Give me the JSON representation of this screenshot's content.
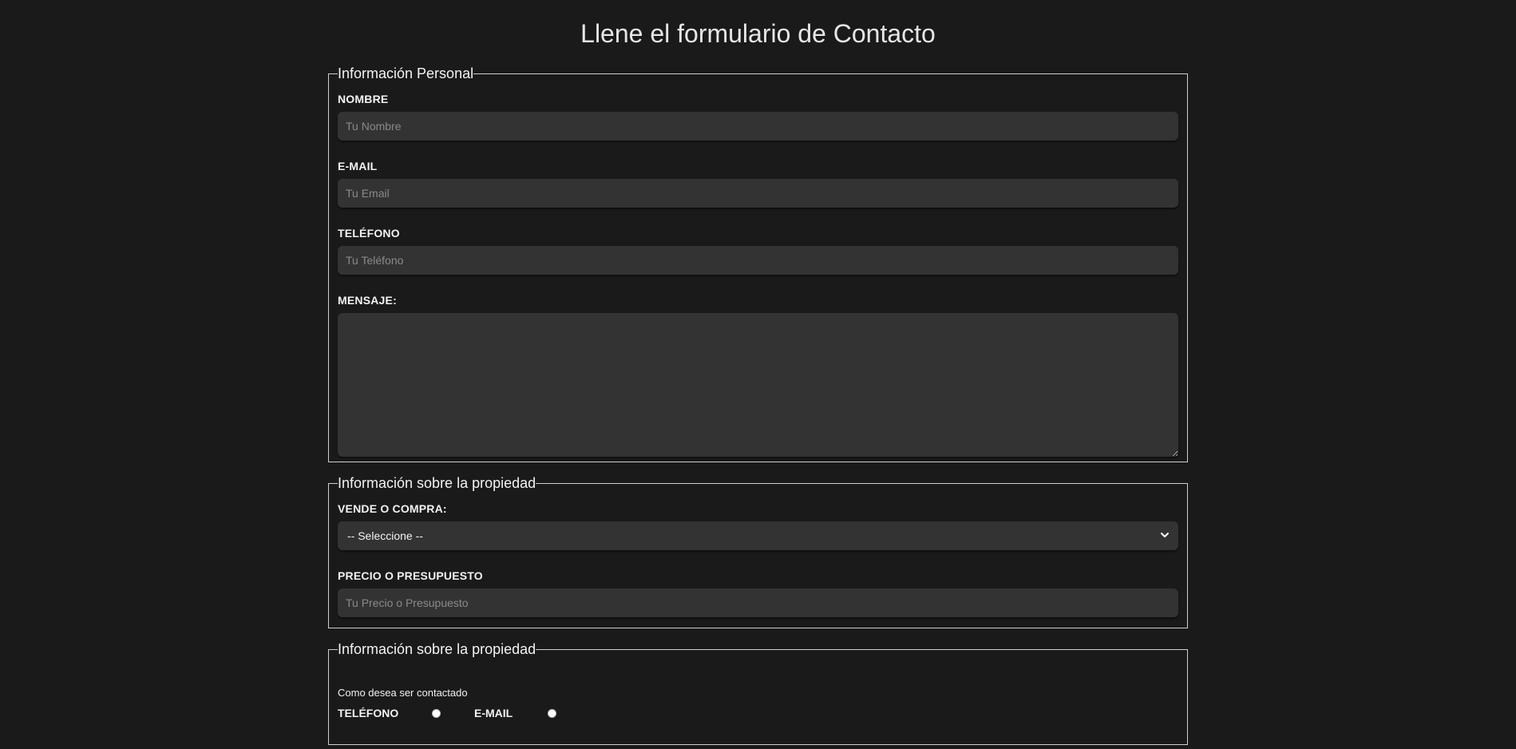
{
  "page": {
    "title": "Llene el formulario de Contacto"
  },
  "personal": {
    "legend": "Información Personal",
    "nombre": {
      "label": "Nombre",
      "placeholder": "Tu Nombre",
      "value": ""
    },
    "email": {
      "label": "E-mail",
      "placeholder": "Tu Email",
      "value": ""
    },
    "telefono": {
      "label": "Teléfono",
      "placeholder": "Tu Teléfono",
      "value": ""
    },
    "mensaje": {
      "label": "Mensaje:",
      "value": ""
    }
  },
  "propiedad": {
    "legend": "Información sobre la propiedad",
    "vende_compra": {
      "label": "Vende o Compra:",
      "selected": "-- Seleccione --"
    },
    "precio": {
      "label": "Precio o Presupuesto",
      "placeholder": "Tu Precio o Presupuesto",
      "value": ""
    }
  },
  "contacto": {
    "legend": "Información sobre la propiedad",
    "prompt": "Como desea ser contactado",
    "options": [
      {
        "label": "Teléfono",
        "checked": false
      },
      {
        "label": "E-mail",
        "checked": false
      }
    ]
  },
  "colors": {
    "background": "#1a1a1a",
    "input_background": "#333333",
    "border": "#cfcfcf",
    "text": "#ffffff"
  },
  "icons": {
    "select_arrow": "chevron-down-icon"
  }
}
